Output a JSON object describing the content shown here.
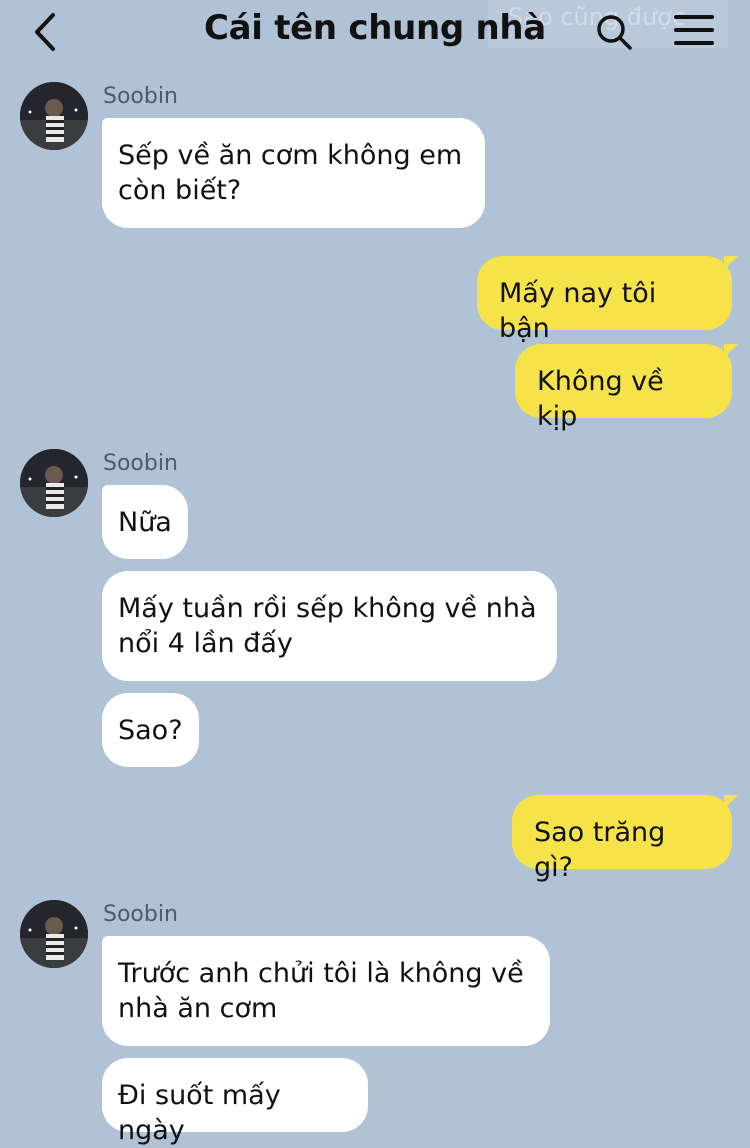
{
  "header": {
    "title": "Cái tên chung nhà",
    "ghost_text": "Sao cũng được",
    "back_icon": "chevron-left-icon",
    "search_icon": "search-icon",
    "menu_icon": "hamburger-menu-icon"
  },
  "colors": {
    "background": "#b0c2d5",
    "incoming_bubble": "#ffffff",
    "outgoing_bubble": "#f6e34a"
  },
  "messages": [
    {
      "sender": "Soobin",
      "text": "Sếp về ăn cơm không em còn biết?"
    },
    {
      "direction": "out",
      "text": "Mấy nay tôi bận"
    },
    {
      "direction": "out",
      "text": "Không về kịp"
    },
    {
      "sender": "Soobin",
      "text": "Nữa"
    },
    {
      "sender": "",
      "text": "Mấy tuần rồi sếp không về nhà nổi 4 lần đấy"
    },
    {
      "sender": "",
      "text": "Sao?"
    },
    {
      "direction": "out",
      "text": "Sao trăng gì?"
    },
    {
      "sender": "Soobin",
      "text": "Trước anh chửi tôi là không về nhà ăn cơm"
    },
    {
      "sender": "",
      "text": "Đi suốt mấy ngày"
    }
  ]
}
